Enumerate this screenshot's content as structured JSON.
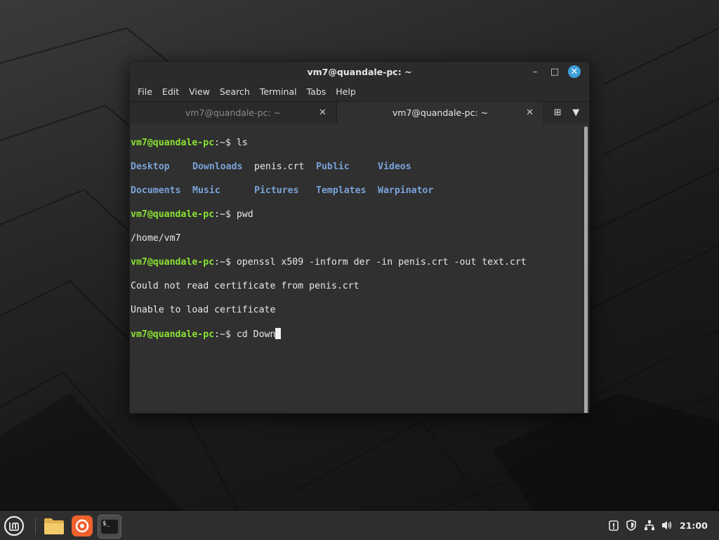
{
  "window": {
    "title": "vm7@quandale-pc: ~",
    "controls": {
      "minimize": "–",
      "maximize": "□",
      "close": "✕"
    }
  },
  "menu": [
    "File",
    "Edit",
    "View",
    "Search",
    "Terminal",
    "Tabs",
    "Help"
  ],
  "tabs": [
    {
      "label": "vm7@quandale-pc: ~",
      "active": false,
      "close": "✕"
    },
    {
      "label": "vm7@quandale-pc: ~",
      "active": true,
      "close": "✕"
    }
  ],
  "tab_tools": {
    "new_tab": "⊞",
    "dropdown": "▼"
  },
  "terminal": {
    "prompt_user": "vm7@quandale-pc",
    "prompt_tail": ":~$ ",
    "cmd_ls": "ls",
    "ls_row1": [
      "Desktop",
      "Downloads",
      "penis.crt",
      "Public",
      "Videos"
    ],
    "ls_row2": [
      "Documents",
      "Music",
      "Pictures",
      "Templates",
      "Warpinator"
    ],
    "cmd_pwd": "pwd",
    "out_pwd": "/home/vm7",
    "cmd_openssl": "openssl x509 -inform der -in penis.crt -out text.crt",
    "err1": "Could not read certificate from penis.crt",
    "err2": "Unable to load certificate",
    "cmd_current": "cd Down"
  },
  "taskbar": {
    "clock": "21:00",
    "apps": [
      "mint-menu-icon",
      "files-icon",
      "firefox-icon",
      "terminal-icon"
    ],
    "tray": [
      "update-manager-icon",
      "shield-icon",
      "network-icon",
      "volume-icon"
    ]
  },
  "colors": {
    "prompt": "#8ae234",
    "directory": "#7aa2d8",
    "close_button": "#3e9fd8",
    "terminal_bg": "#303030"
  }
}
